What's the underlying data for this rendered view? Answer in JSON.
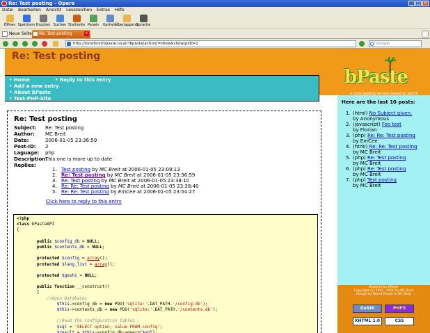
{
  "window": {
    "title": "Re: Test posting - Opera"
  },
  "menu": [
    "Datei",
    "Bearbeiten",
    "Ansicht",
    "Lesezeichen",
    "Extras",
    "Hilfe"
  ],
  "toolbar": [
    {
      "label": "Öffnen",
      "icon": "open-folder-icon",
      "color": "#e8b84a"
    },
    {
      "label": "Speichern",
      "icon": "save-icon",
      "color": "#3a6fd8"
    },
    {
      "label": "Drucken",
      "icon": "print-icon",
      "color": "#777777"
    },
    {
      "label": "Suchen",
      "icon": "search-icon",
      "color": "#4a8ad8"
    },
    {
      "label": "Startseite",
      "icon": "home-icon",
      "color": "#c85e14"
    },
    {
      "label": "Panels",
      "icon": "panels-icon",
      "color": "#5aa05a"
    },
    {
      "label": "Kacheln",
      "icon": "tile-icon",
      "color": "#6a8ac8"
    },
    {
      "label": "Überlappend",
      "icon": "cascade-icon",
      "color": "#e8b84a"
    },
    {
      "label": "Sprache",
      "icon": "microphone-icon",
      "color": "#555555"
    }
  ],
  "tabs": {
    "new_page": "Neue Seite",
    "active": "Re: Test posting"
  },
  "address": {
    "url": "http://localhost/bpaste.local/?bpaste[action]=show&show[pid]=2",
    "search_placeholder": "Google"
  },
  "page": {
    "title": "Re: Test posting",
    "logo_text": "bPaste",
    "logo_sub": "a code pasting service based on GeSHi",
    "nav_left": [
      "Home",
      "Add a new entry",
      "About bPaste",
      "Test-PHP-Site"
    ],
    "nav_right": [
      "Reply to this entry"
    ]
  },
  "post": {
    "heading": "Re: Test posting",
    "fields": [
      {
        "key": "Subject:",
        "value": "Re: Test posting"
      },
      {
        "key": "Author:",
        "value": "MC Breit"
      },
      {
        "key": "Date:",
        "value": "2006-01-05 23:36:59"
      },
      {
        "key": "Post-ID:",
        "value": "2"
      },
      {
        "key": "Laguage:",
        "value": "php"
      },
      {
        "key": "Description:",
        "value": "This one is more up to date"
      },
      {
        "key": "Replies:",
        "value": ""
      }
    ],
    "replies": [
      {
        "num": "1.",
        "title": "Test posting",
        "by": " by ",
        "author": "MC Breit",
        "date": " at 2006-01-05 23:08:13",
        "visited": false
      },
      {
        "num": "2.",
        "title": "Re: Test posting",
        "by": " by ",
        "author": "MC Breit",
        "date": " at 2006-01-05 23:36:59",
        "visited": true
      },
      {
        "num": "3.",
        "title": "Re: Test posting",
        "by": " by ",
        "author": "MC Breit",
        "date": " at 2006-01-05 23:38:10",
        "visited": false
      },
      {
        "num": "4.",
        "title": "Re: Re: Test posting",
        "by": " by ",
        "author": "MC Breit",
        "date": " at 2006-01-05 23:38:40",
        "visited": false
      },
      {
        "num": "5.",
        "title": "Re: Re: Test posting",
        "by": " by ",
        "author": "EmCee",
        "date": " at 2006-01-05 23:54:27",
        "visited": false
      }
    ],
    "reply_link": "Click here to reply to this entry"
  },
  "code": [
    [
      {
        "t": "<?php",
        "c": "kw"
      }
    ],
    [
      {
        "t": "class ",
        "c": "kw"
      },
      {
        "t": "bPasteAPI",
        "c": ""
      }
    ],
    [
      {
        "t": "{",
        "c": ""
      }
    ],
    [
      {
        "t": "",
        "c": ""
      }
    ],
    [
      {
        "t": "        public ",
        "c": "kw"
      },
      {
        "t": "$config_db",
        "c": "va"
      },
      {
        "t": " = ",
        "c": ""
      },
      {
        "t": "NULL",
        "c": "kw"
      },
      {
        "t": ";",
        "c": ""
      }
    ],
    [
      {
        "t": "        public ",
        "c": "kw"
      },
      {
        "t": "$contents_db",
        "c": "va"
      },
      {
        "t": " = ",
        "c": ""
      },
      {
        "t": "NULL",
        "c": "kw"
      },
      {
        "t": ";",
        "c": ""
      }
    ],
    [
      {
        "t": "",
        "c": ""
      }
    ],
    [
      {
        "t": "        protected ",
        "c": "kw"
      },
      {
        "t": "$config",
        "c": "va"
      },
      {
        "t": " = ",
        "c": ""
      },
      {
        "t": "array",
        "c": "fn"
      },
      {
        "t": "();",
        "c": ""
      }
    ],
    [
      {
        "t": "        protected ",
        "c": "kw"
      },
      {
        "t": "$lang_list",
        "c": "va"
      },
      {
        "t": " = ",
        "c": ""
      },
      {
        "t": "array",
        "c": "fn"
      },
      {
        "t": "();",
        "c": ""
      }
    ],
    [
      {
        "t": "",
        "c": ""
      }
    ],
    [
      {
        "t": "        protected ",
        "c": "kw"
      },
      {
        "t": "$geshi",
        "c": "va"
      },
      {
        "t": " = ",
        "c": ""
      },
      {
        "t": "NULL",
        "c": "kw"
      },
      {
        "t": ";",
        "c": ""
      }
    ],
    [
      {
        "t": "",
        "c": ""
      }
    ],
    [
      {
        "t": "        public function ",
        "c": "kw"
      },
      {
        "t": "__construct()",
        "c": ""
      }
    ],
    [
      {
        "t": "        {",
        "c": ""
      }
    ],
    [
      {
        "t": "            //Open Databases",
        "c": "cm"
      }
    ],
    [
      {
        "t": "                ",
        "c": ""
      },
      {
        "t": "$this",
        "c": "va"
      },
      {
        "t": "->config_db = ",
        "c": ""
      },
      {
        "t": "new ",
        "c": "kw"
      },
      {
        "t": "PDO(",
        "c": ""
      },
      {
        "t": "'sqlite:'",
        "c": "st"
      },
      {
        "t": ".DAT_PATH.",
        "c": ""
      },
      {
        "t": "'/config.db'",
        "c": "st"
      },
      {
        "t": ");",
        "c": ""
      }
    ],
    [
      {
        "t": "                ",
        "c": ""
      },
      {
        "t": "$this",
        "c": "va"
      },
      {
        "t": "->contents_db = ",
        "c": ""
      },
      {
        "t": "new ",
        "c": "kw"
      },
      {
        "t": "PDO(",
        "c": ""
      },
      {
        "t": "'sqlite:'",
        "c": "st"
      },
      {
        "t": ".DAT_PATH.",
        "c": ""
      },
      {
        "t": "'/contents.db'",
        "c": "st"
      },
      {
        "t": ");",
        "c": ""
      }
    ],
    [
      {
        "t": "",
        "c": ""
      }
    ],
    [
      {
        "t": "                //Read the configuration tables..",
        "c": "cm"
      }
    ],
    [
      {
        "t": "                ",
        "c": ""
      },
      {
        "t": "$sql",
        "c": "va"
      },
      {
        "t": " = ",
        "c": ""
      },
      {
        "t": "'SELECT option, value FROM config'",
        "c": "st"
      },
      {
        "t": ";",
        "c": ""
      }
    ],
    [
      {
        "t": "                ",
        "c": ""
      },
      {
        "t": "$result",
        "c": "va"
      },
      {
        "t": " = ",
        "c": ""
      },
      {
        "t": "$this",
        "c": "va"
      },
      {
        "t": "->config_db->query(",
        "c": ""
      },
      {
        "t": "$sql",
        "c": "va"
      },
      {
        "t": ");",
        "c": ""
      }
    ]
  ],
  "sidebar": {
    "heading": "Here are the last 10 posts:",
    "items": [
      {
        "num": "1.",
        "lang": "(html) ",
        "title": "No Subject given.",
        "author": "by Anonymous"
      },
      {
        "num": "2.",
        "lang": "(javascript) ",
        "title": "Foo test",
        "author": "by Florian"
      },
      {
        "num": "3.",
        "lang": "(php) ",
        "title": "Re: Re: Test posting",
        "author": "by EmCee"
      },
      {
        "num": "4.",
        "lang": "(html) ",
        "title": "Re: Re: Test posting",
        "author": "by MC Breit"
      },
      {
        "num": "5.",
        "lang": "(php) ",
        "title": "Re: Test posting",
        "author": "by MC Breit"
      },
      {
        "num": "6.",
        "lang": "(php) ",
        "title": "Re: Test posting",
        "author": "by MC Breit"
      },
      {
        "num": "7.",
        "lang": "(php) ",
        "title": "Test posting",
        "author": "by MC Breit"
      }
    ],
    "powered": [
      "Powered by bPaste",
      "Copyright (c) 2005 - 2006 by MC Breit",
      "Design by Bernd Rieder & MC Breit"
    ],
    "badges": [
      "GeSHi",
      "PHP5",
      "XHTML 1.0",
      "CSS"
    ]
  }
}
